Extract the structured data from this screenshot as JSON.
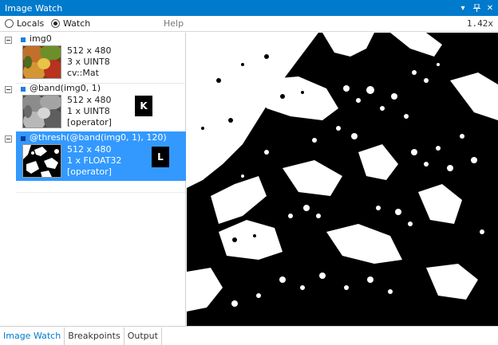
{
  "window": {
    "title": "Image Watch"
  },
  "toolbar": {
    "locals_label": "Locals",
    "watch_label": "Watch",
    "selected_mode": "Watch",
    "help_label": "Help",
    "zoom_level": "1.42x"
  },
  "entries": [
    {
      "name": "img0",
      "size": "512 x 480",
      "channels": "3 x UINT8",
      "type": "cv::Mat"
    },
    {
      "name": "@band(img0, 1)",
      "size": "512 x 480",
      "channels": "1 x UINT8",
      "type": "[operator]"
    },
    {
      "name": "@thresh(@band(img0, 1), 120)",
      "size": "512 x 480",
      "channels": "1 x FLOAT32",
      "type": "[operator]"
    }
  ],
  "badges": {
    "k": "K",
    "l": "L"
  },
  "bottom_tabs": [
    "Image Watch",
    "Breakpoints",
    "Output"
  ],
  "colors": {
    "accent": "#007acc",
    "selection": "#3399ff"
  },
  "icons": {
    "dropdown": "caret-down-icon",
    "pin": "pin-icon",
    "close": "close-icon"
  }
}
